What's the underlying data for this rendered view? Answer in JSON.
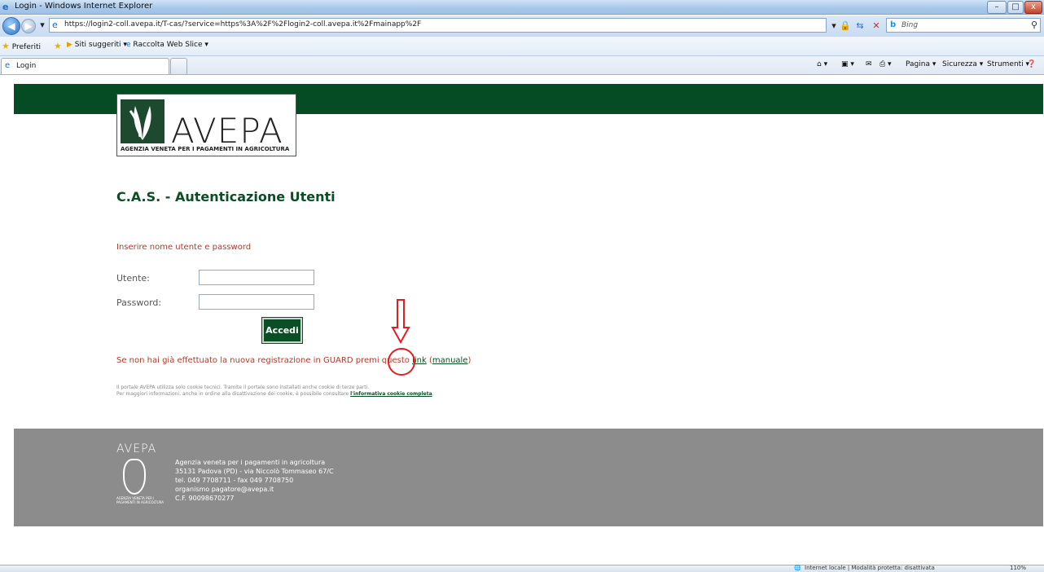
{
  "window": {
    "title": "Login - Windows Internet Explorer",
    "url": "https://login2-coll.avepa.it/T-cas/?service=https%3A%2F%2Flogin2-coll.avepa.it%2Fmainapp%2F",
    "search_placeholder": "Bing",
    "buttons": {
      "minimize": "–",
      "maximize": "□",
      "close": "x"
    }
  },
  "favorites_bar": {
    "favorites": "Preferiti",
    "suggested": "Siti suggeriti ▾",
    "web_slice": "Raccolta Web Slice ▾"
  },
  "tab": {
    "label": "Login"
  },
  "command_bar": {
    "page": "Pagina ▾",
    "security": "Sicurezza ▾",
    "tools": "Strumenti ▾"
  },
  "page": {
    "logo_word": "AVEPA",
    "logo_tagline": "AGENZIA VENETA PER I PAGAMENTI IN AGRICOLTURA",
    "title": "C.A.S. - Autenticazione Utenti",
    "prompt": "Inserire nome utente e password",
    "username_label": "Utente:",
    "password_label": "Password:",
    "login_button": "Accedi",
    "register_text": "Se non hai già effettuato la nuova registrazione in GUARD premi questo ",
    "register_link": "link",
    "manual_prefix": " (",
    "manual_link": "manuale",
    "manual_suffix": ")",
    "cookie_line1": "Il portale AVEPA utilizza solo cookie tecnici. Tramite il portale sono installati anche cookie di terze parti.",
    "cookie_line2": "Per maggiori informazioni, anche in ordine alla disattivazione dei cookie, è possibile consultare ",
    "cookie_link": "l'informativa cookie completa",
    "cookie_end": "."
  },
  "footer": {
    "logo_word": "AVEPA",
    "logo_tagline": "AGENZIA VENETA PER I PAGAMENTI IN AGRICOLTURA",
    "lines": [
      "Agenzia veneta per i pagamenti in agricoltura",
      "35131 Padova (PD) - via Niccolò Tommaseo 67/C",
      "tel. 049 7708711 - fax 049 7708750",
      "organismo pagatore@avepa.it",
      "C.F. 90098670277"
    ]
  },
  "status_bar": {
    "zone": "Internet locale | Modalità protetta: disattivata",
    "zoom": "110%"
  },
  "colors": {
    "brand_green": "#054b24",
    "accent_red": "#b03a2e",
    "footer_gray": "#8c8c8c",
    "annotation_red": "#e02020"
  }
}
